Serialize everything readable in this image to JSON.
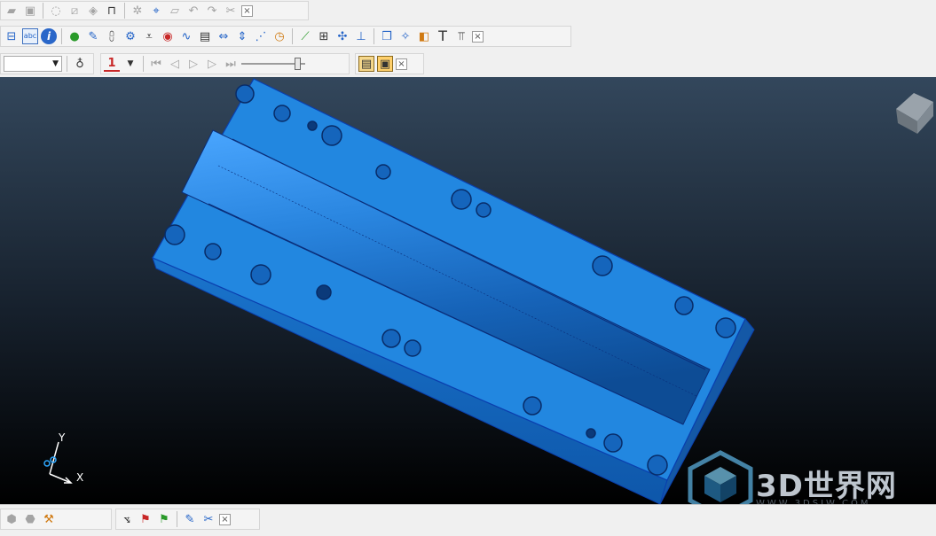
{
  "toolbar_row1": {
    "icons": [
      "open-icon",
      "save-icon",
      "lasso-icon",
      "ruler-icon",
      "layers-icon",
      "chair-icon",
      "snap-icon",
      "transform-icon",
      "eraser-icon",
      "undo-icon",
      "redo-icon",
      "scissors-icon"
    ],
    "close_label": "×"
  },
  "toolbar_row2": {
    "labels": {
      "abc": "abc",
      "info": "i"
    },
    "close_label": "×"
  },
  "toolbar_row3": {
    "step_value": "1",
    "close_label": "×"
  },
  "viewport": {
    "axis_x_label": "X",
    "axis_y_label": "Y"
  },
  "watermark": {
    "brand": "3D世界网",
    "url": "WWW.3DSJW.COM"
  },
  "bottom_toolbar": {
    "close_label": "×"
  },
  "colors": {
    "part_blue": "#1f7fd6",
    "part_edge": "#0a3fae",
    "viewport_top": "#33475c",
    "viewport_bottom": "#000000"
  }
}
